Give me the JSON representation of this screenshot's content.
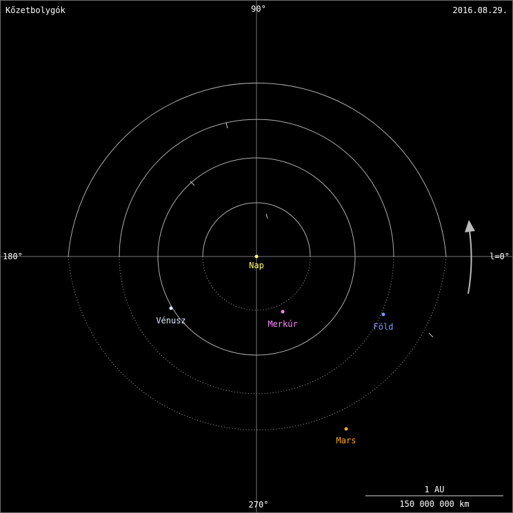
{
  "title": "Kőzetbolygók",
  "date": "2016.08.29.",
  "axis_labels": {
    "top": "90°",
    "bottom": "270°",
    "left": "180°",
    "right": "l=0°"
  },
  "sun": {
    "name": "Nap",
    "color": "#ffff66"
  },
  "planets": [
    {
      "name": "Merkúr",
      "color": "#ff88ff",
      "longitude_deg": 286
    },
    {
      "name": "Vénusz",
      "color": "#ddeeff",
      "longitude_deg": 211
    },
    {
      "name": "Föld",
      "color": "#8899ff",
      "longitude_deg": 336
    },
    {
      "name": "Mars",
      "color": "#ffaa22",
      "longitude_deg": 297
    }
  ],
  "scale_bar": {
    "top_label": "1 AU",
    "bottom_label": "150 000 000 km"
  },
  "colors": {
    "grid": "#7a7a7a",
    "orbit": "#b0b0b0",
    "text": "#ffffff",
    "arrow": "#bbbbbb"
  }
}
